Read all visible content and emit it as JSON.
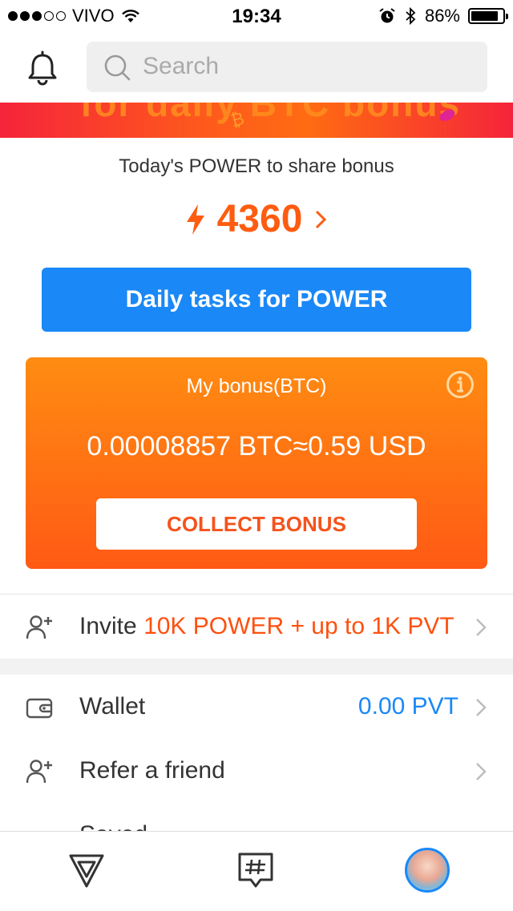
{
  "status_bar": {
    "carrier": "VIVO",
    "time": "19:34",
    "battery": "86%",
    "battery_level": 0.86
  },
  "header": {
    "search_placeholder": "Search"
  },
  "banner": {
    "partial_text": "for daily BTC bonus"
  },
  "power": {
    "caption": "Today's POWER to share bonus",
    "value": "4360"
  },
  "tasks_button": {
    "label": "Daily tasks for POWER"
  },
  "bonus": {
    "title": "My bonus(BTC)",
    "amount": "0.00008857 BTC≈0.59 USD",
    "collect_label": "COLLECT BONUS"
  },
  "invite": {
    "label": "Invite",
    "highlight": "10K POWER + up to 1K PVT"
  },
  "menu": {
    "wallet_label": "Wallet",
    "wallet_value": "0.00 PVT",
    "refer_label": "Refer a friend",
    "partial_label": "Saved"
  },
  "colors": {
    "accent_blue": "#1a88f7",
    "accent_orange": "#fe5c10"
  }
}
